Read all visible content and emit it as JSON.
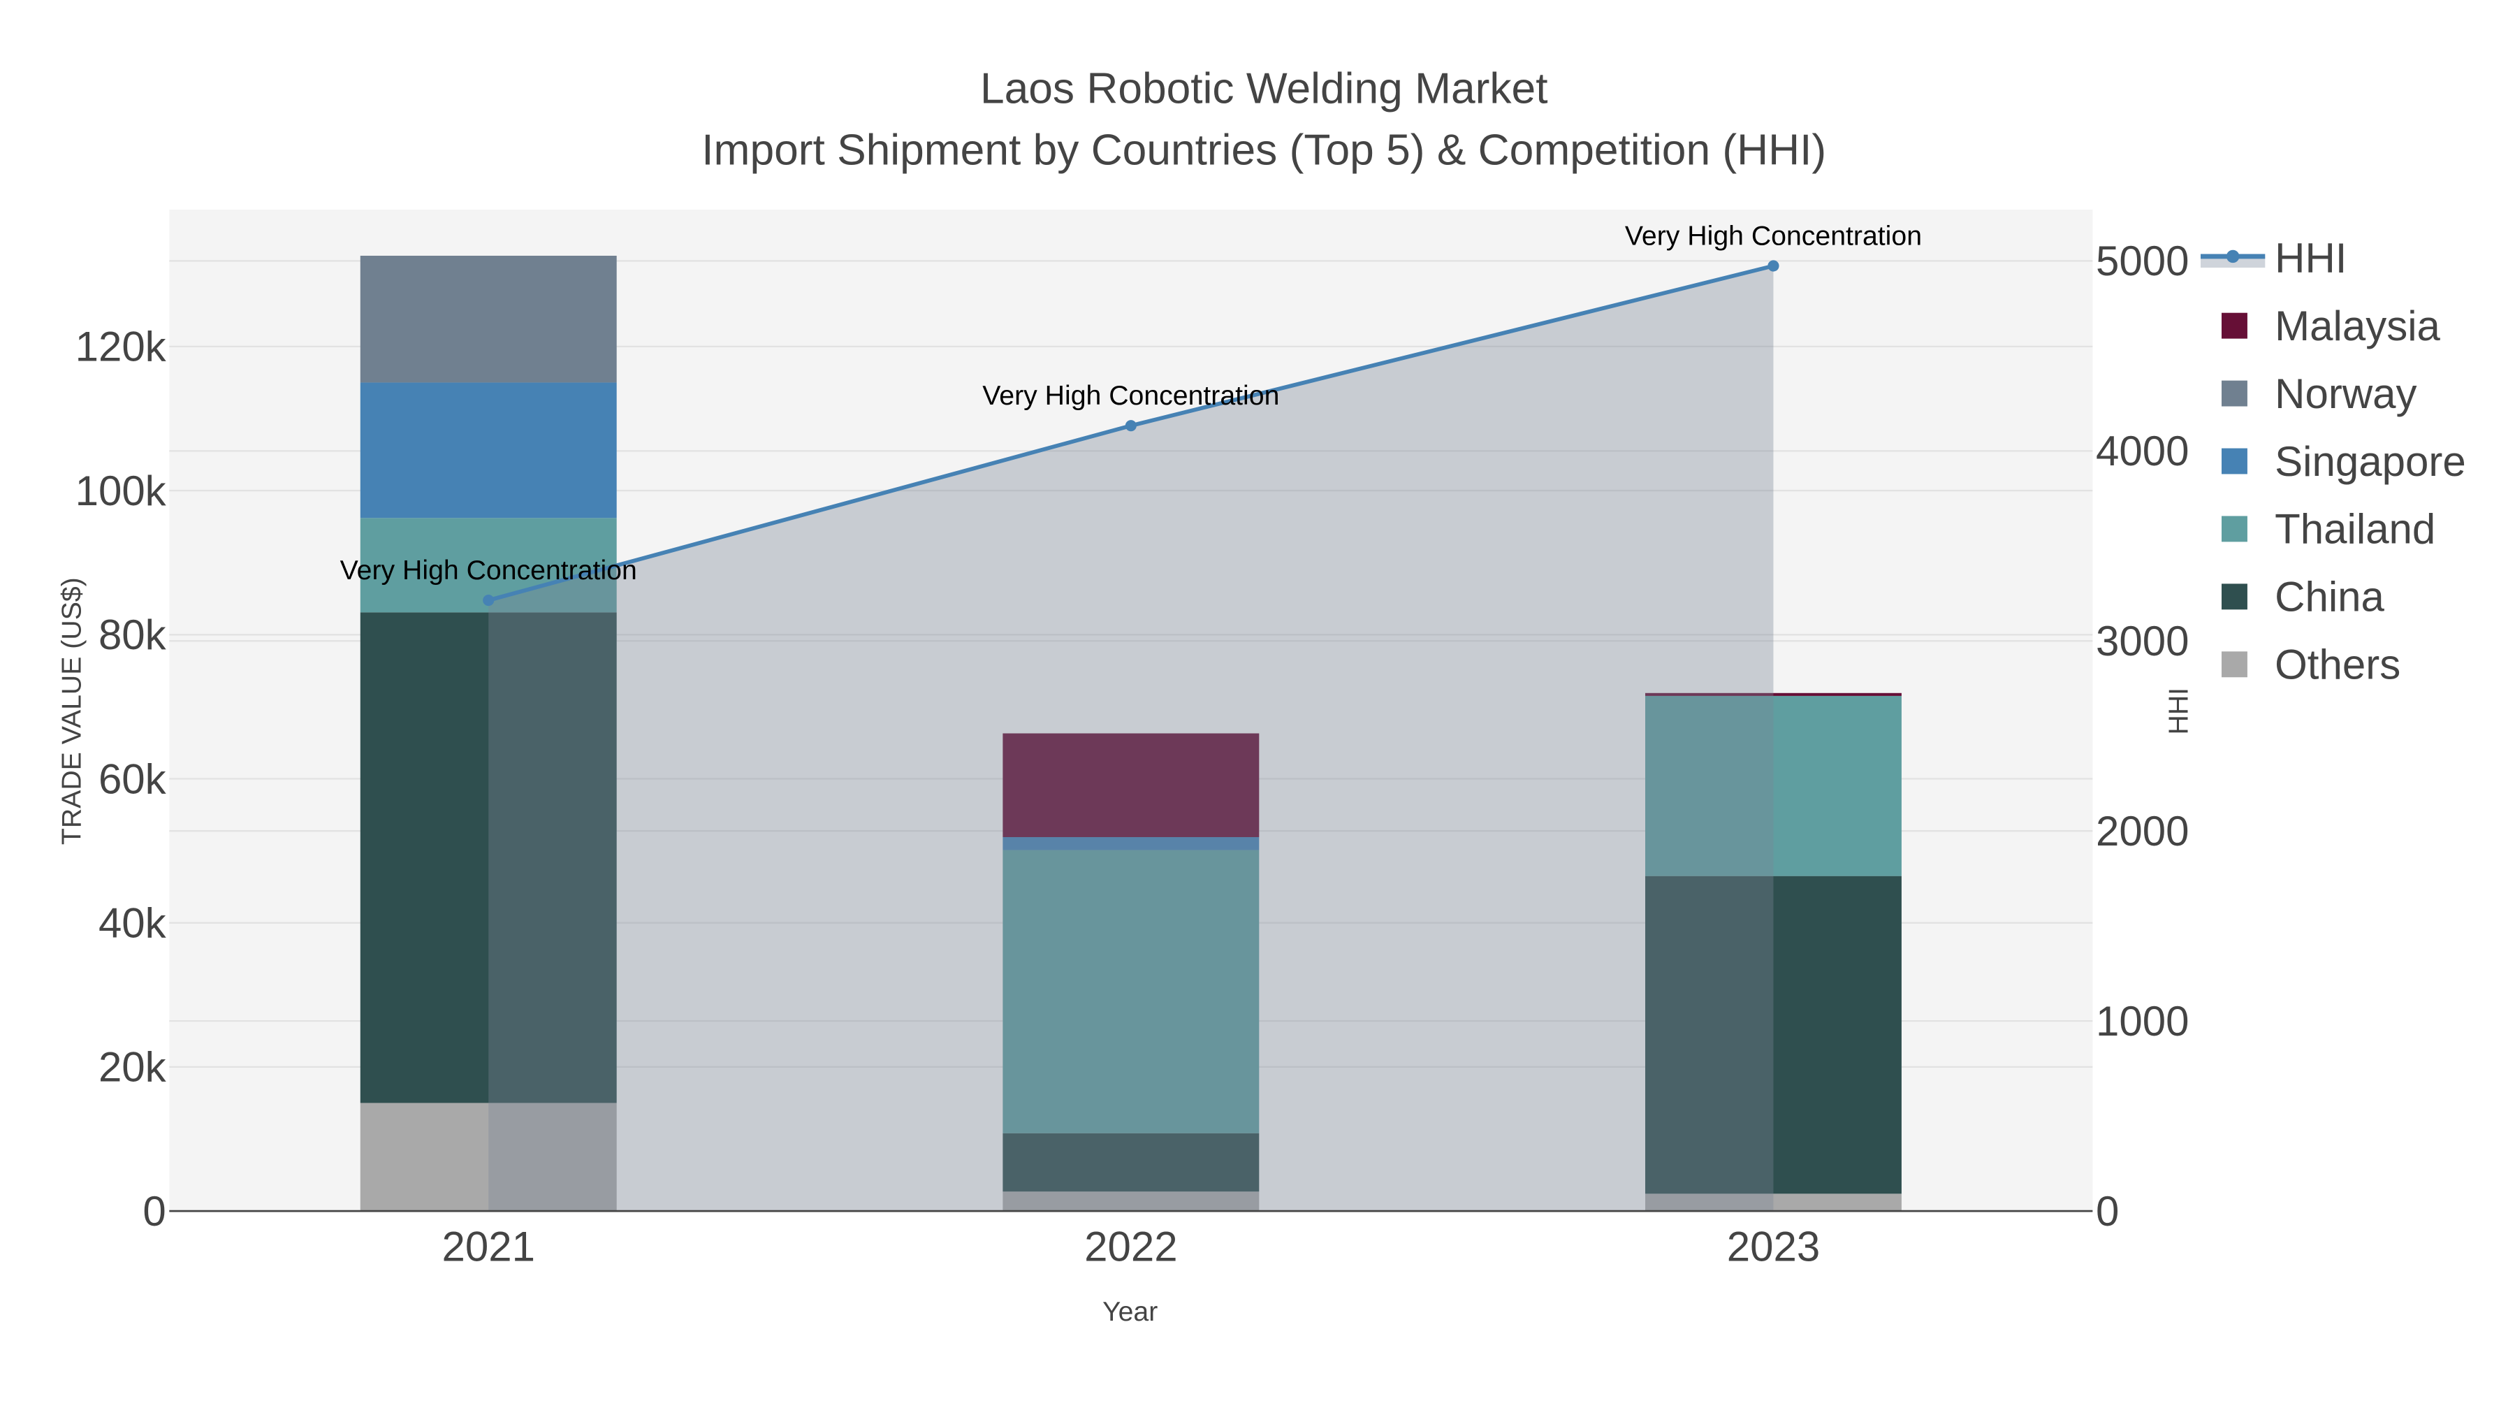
{
  "chart_data": {
    "type": "bar",
    "title": "Laos Robotic Welding Market",
    "subtitle": "Import Shipment by Countries (Top 5) & Competition (HHI)",
    "xlabel": "Year",
    "ylabel": "TRADE VALUE (US$)",
    "y2label": "HHI",
    "categories": [
      "2021",
      "2022",
      "2023"
    ],
    "ylim": [
      0,
      139000
    ],
    "y2lim": [
      0,
      5270
    ],
    "yticks": [
      0,
      20000,
      40000,
      60000,
      80000,
      100000,
      120000
    ],
    "yticklabels": [
      "0",
      "20k",
      "40k",
      "60k",
      "80k",
      "100k",
      "120k"
    ],
    "y2ticks": [
      0,
      1000,
      2000,
      3000,
      4000,
      5000
    ],
    "y2ticklabels": [
      "0",
      "1000",
      "2000",
      "3000",
      "4000",
      "5000"
    ],
    "grid": true,
    "stacked": true,
    "series": [
      {
        "name": "Others",
        "color": "#a9a9a9",
        "values": [
          15000,
          2700,
          2400
        ]
      },
      {
        "name": "China",
        "color": "#2f4f4f",
        "values": [
          68100,
          8100,
          44100
        ]
      },
      {
        "name": "Thailand",
        "color": "#5f9ea0",
        "values": [
          13100,
          39300,
          25000
        ]
      },
      {
        "name": "Singapore",
        "color": "#4682b4",
        "values": [
          18800,
          1800,
          0
        ]
      },
      {
        "name": "Norway",
        "color": "#708090",
        "values": [
          17600,
          0,
          0
        ]
      },
      {
        "name": "Malaysia",
        "color": "#660f36",
        "values": [
          0,
          14400,
          400
        ]
      }
    ],
    "line": {
      "name": "HHI",
      "color": "#4682b4",
      "values": [
        3214,
        4133,
        4974
      ],
      "axis": "right",
      "fill": "tozeroy"
    },
    "annotations": [
      "Very High Concentration",
      "Very High Concentration",
      "Very High Concentration"
    ],
    "legend": {
      "position": "right",
      "order": [
        "HHI",
        "Malaysia",
        "Norway",
        "Singapore",
        "Thailand",
        "China",
        "Others"
      ]
    }
  }
}
